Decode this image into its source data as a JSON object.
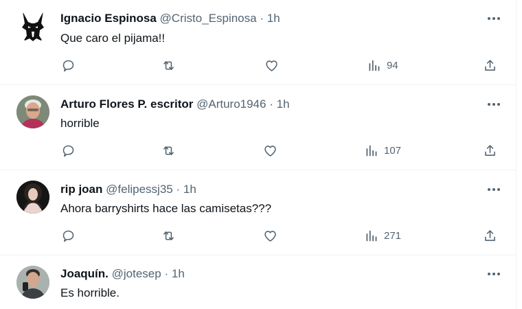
{
  "tweets": [
    {
      "name": "Ignacio Espinosa",
      "handle": "@Cristo_Espinosa",
      "separator": "·",
      "time": "1h",
      "text": "Que caro el pijama!!",
      "views": "94",
      "avatar": "anubis-logo"
    },
    {
      "name": "Arturo Flores P. escritor",
      "handle": "@Arturo1946",
      "separator": "·",
      "time": "1h",
      "text": "horrible",
      "views": "107",
      "avatar": "photo-older-man"
    },
    {
      "name": "rip joan",
      "handle": "@felipessj35",
      "separator": "·",
      "time": "1h",
      "text": "Ahora barryshirts hace las camisetas???",
      "views": "271",
      "avatar": "photo-woman"
    },
    {
      "name": "Joaquín.",
      "handle": "@jotesep",
      "separator": "·",
      "time": "1h",
      "text": "Es horrible.",
      "avatar": "photo-young-man"
    }
  ],
  "icons": {
    "reply": "reply-icon",
    "retweet": "retweet-icon",
    "like": "like-icon",
    "views": "views-icon",
    "share": "share-icon",
    "more": "more-icon"
  },
  "colors": {
    "text": "#0f1419",
    "secondary": "#536471",
    "border": "#eff3f4"
  }
}
